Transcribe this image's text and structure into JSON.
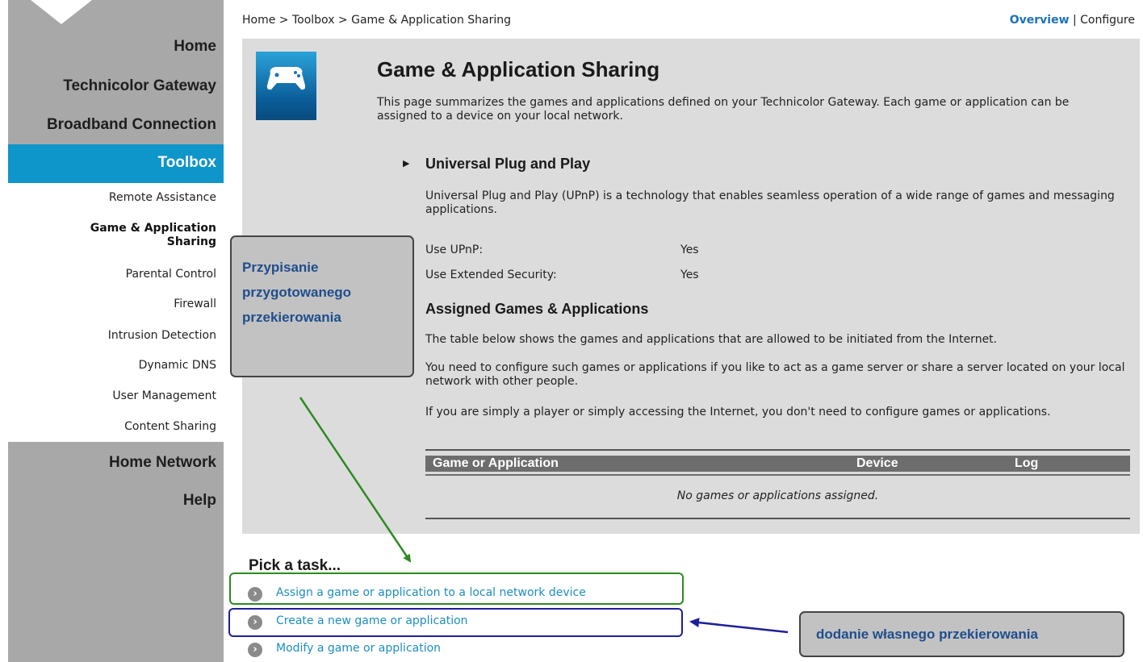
{
  "sidebar": {
    "items": {
      "home": "Home",
      "gateway": "Technicolor Gateway",
      "broadband": "Broadband Connection",
      "toolbox": "Toolbox",
      "home_network": "Home Network",
      "help": "Help"
    },
    "submenu": [
      "Remote Assistance",
      "Game & Application",
      "Sharing",
      "Parental Control",
      "Firewall",
      "Intrusion Detection",
      "Dynamic DNS",
      "User Management",
      "Content Sharing"
    ]
  },
  "header": {
    "breadcrumb": "Home > Toolbox > Game & Application Sharing",
    "overview": "Overview",
    "separator": "|",
    "configure": "Configure"
  },
  "main": {
    "icon": "gamepad-icon",
    "title": "Game & Application Sharing",
    "intro": "This page summarizes the games and applications defined on your Technicolor Gateway. Each game or application can be assigned to a device on your local network.",
    "upnp": {
      "heading": "Universal Plug and Play",
      "description": "Universal Plug and Play (UPnP) is a technology that enables seamless operation of a wide range of games and messaging applications.",
      "use_upnp_label": "Use UPnP:",
      "use_upnp_value": "Yes",
      "ext_security_label": "Use Extended Security:",
      "ext_security_value": "Yes"
    },
    "assigned": {
      "heading": "Assigned Games & Applications",
      "p1": "The table below shows the games and applications that are allowed to be initiated from the Internet.",
      "p2": "You need to configure such games or applications if you like to act as a game server or share a server located on your local network with other people.",
      "p3": "If you are simply a player or simply accessing the Internet, you don't need to configure games or applications.",
      "table": {
        "columns": [
          "Game or Application",
          "Device",
          "Log"
        ],
        "empty": "No games or applications assigned."
      }
    }
  },
  "tasks": {
    "heading": "Pick a task...",
    "items": [
      "Assign a game or application to a local network device",
      "Create a new game or application",
      "Modify a game or application"
    ]
  },
  "annotations": {
    "left_note": [
      "Przypisanie",
      "przygotowanego",
      "przekierowania"
    ],
    "right_note": "dodanie własnego przekierowania",
    "colors": {
      "green": "#2d8a22",
      "blue": "#1f1f9a",
      "note_text": "#1f4e8c"
    }
  },
  "colors": {
    "accent": "#0e95c9",
    "sidebar": "#a8a8a8",
    "panel": "#dcdcdc",
    "link": "#1e8dc3"
  }
}
